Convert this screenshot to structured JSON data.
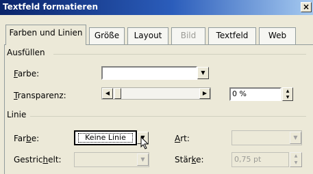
{
  "window": {
    "title": "Textfeld formatieren",
    "close_label": "×"
  },
  "tabs": [
    {
      "label": "Farben und Linien",
      "active": true,
      "enabled": true
    },
    {
      "label": "Größe",
      "enabled": true
    },
    {
      "label": "Layout",
      "enabled": true
    },
    {
      "label": "Bild",
      "enabled": false
    },
    {
      "label": "Textfeld",
      "enabled": true
    },
    {
      "label": "Web",
      "enabled": true
    }
  ],
  "fill": {
    "section_title": "Ausfüllen",
    "color_label_mnemonic": "F",
    "color_label_rest": "arbe:",
    "color_value": "",
    "transparency_label_mnemonic": "T",
    "transparency_label_rest": "ransparenz:",
    "transparency_value": "0 %",
    "transparency_level": 0.0
  },
  "line": {
    "section_title": "Linie",
    "color_label_pre": "Far",
    "color_label_mnemonic": "b",
    "color_label_post": "e:",
    "color_value": "Keine Linie",
    "style_label_mnemonic": "A",
    "style_label_rest": "rt:",
    "style_value": "",
    "dashed_label_pre": "Gestric",
    "dashed_label_mnemonic": "h",
    "dashed_label_post": "elt:",
    "dashed_value": "",
    "weight_label_pre": "Stär",
    "weight_label_mnemonic": "k",
    "weight_label_post": "e:",
    "weight_value": "0,75 pt"
  },
  "colors": {
    "titlebar_start": "#0a246a",
    "titlebar_end": "#a6caf0",
    "dialog_bg": "#ece9d8"
  }
}
